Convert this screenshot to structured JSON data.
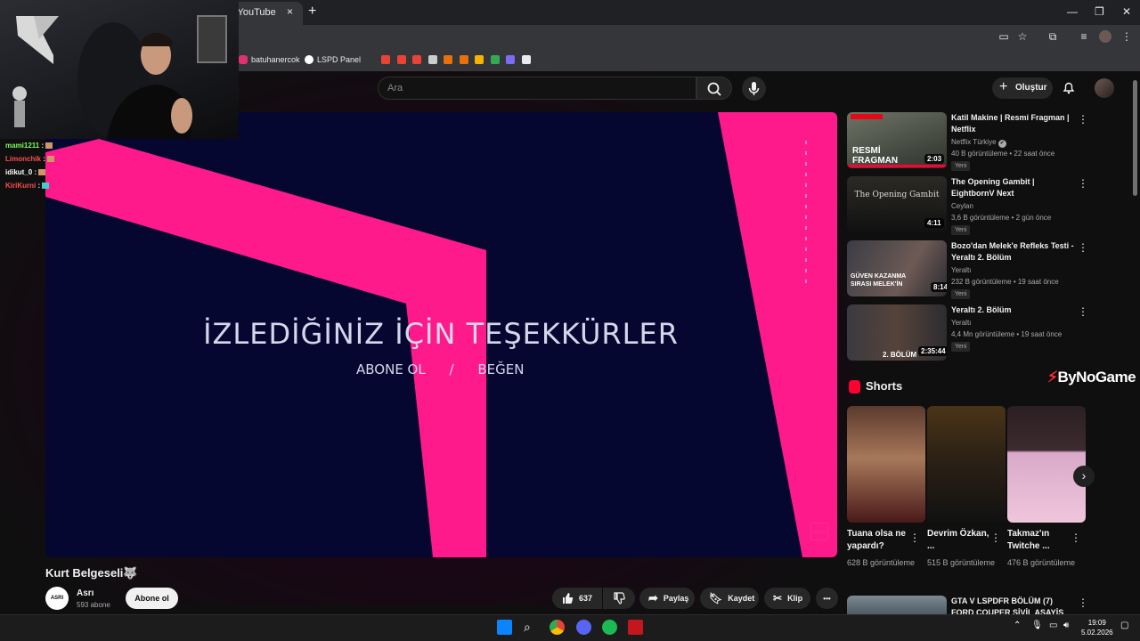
{
  "browser": {
    "tab_title": "- YouTube",
    "tab_close": "×",
    "new_tab": "+",
    "window_controls": [
      "—",
      "❐",
      "✕"
    ],
    "bookmarks": [
      {
        "label": "batuhanercok",
        "color": "#e1306c"
      },
      {
        "label": "LSPD Panel",
        "color": "#ffffff"
      }
    ],
    "bookmark_icon_colors": [
      "#ea4335",
      "#ea4335",
      "#ea4335",
      "#cccccc",
      "#e8710a",
      "#e8710a",
      "#f4b400",
      "#34a853",
      "#7c6cf0",
      "#e8eaed"
    ]
  },
  "youtube": {
    "search_placeholder": "Ara",
    "create_label": "Oluştur",
    "video": {
      "end_title": "İZLEDİĞİNİZ İÇİN TEŞEKKÜRLER",
      "end_subtitle_left": "ABONE OL",
      "end_subtitle_sep": "/",
      "end_subtitle_right": "BEĞEN",
      "logo_text": "ASRI",
      "title": "Kurt Belgeseli🐺",
      "channel_name": "Asrı",
      "channel_subs": "593 abone",
      "channel_avatar_text": "ASRI",
      "subscribe_label": "Abone ol",
      "likes": "637",
      "share_label": "Paylaş",
      "save_label": "Kaydet",
      "clip_label": "Klip",
      "more": "•••"
    },
    "related": [
      {
        "title": "Katil Makine | Resmi Fragman | Netflix",
        "channel": "Netflix Türkiye",
        "verified": "✔",
        "meta": "40 B görüntüleme • 22 saat önce",
        "badge": "Yeni",
        "duration": "2:03",
        "thumb_text": "RESMİ FRAGMAN"
      },
      {
        "title": "The Opening Gambit | EightbornV Next",
        "channel": "Ceylan",
        "meta": "3,6 B görüntüleme • 2 gün önce",
        "badge": "Yeni",
        "duration": "4:11",
        "thumb_text": "The Opening Gambit"
      },
      {
        "title": "Bozo'dan Melek'e Refleks Testi - Yeraltı 2. Bölüm",
        "channel": "Yeraltı",
        "meta": "232 B görüntüleme • 19 saat önce",
        "badge": "Yeni",
        "duration": "8:14",
        "thumb_text": "GÜVEN KAZANMA SIRASI MELEK'İN"
      },
      {
        "title": "Yeraltı 2. Bölüm",
        "channel": "Yeraltı",
        "meta": "4,4 Mn görüntüleme • 19 saat önce",
        "badge": "Yeni",
        "duration": "2:35:44",
        "thumb_text": "2. BÖLÜM"
      }
    ],
    "shorts_heading": "Shorts",
    "shorts": [
      {
        "title": "Tuana olsa ne yapardı?",
        "views": "628 B görüntüleme"
      },
      {
        "title": "Devrim Özkan, ...",
        "views": "515 B görüntüleme"
      },
      {
        "title": "Takmaz'ın Twitche ...",
        "views": "476 B görüntüleme"
      }
    ],
    "next_related": {
      "title": "GTA V LSPDFR BÖLÜM (7) FORD COUPER SİVİL ASAYİŞ"
    },
    "sponsor": "ByNoGame"
  },
  "stream_overlay": {
    "chat": [
      {
        "user": "mami1211",
        "color": "#7cff5a"
      },
      {
        "user": "Limonchik",
        "color": "#ff4d4d"
      },
      {
        "user": "idikut_0",
        "color": "#ffffff"
      },
      {
        "user": "KiriKurni",
        "color": "#ff4d4d"
      }
    ],
    "chat_sep": ":"
  },
  "taskbar": {
    "time": "19:09",
    "date": "5.02.2026"
  },
  "colors": {
    "accent_pink": "#ff1a8c",
    "player_bg": "#050731",
    "yt_red": "#ff0033"
  }
}
